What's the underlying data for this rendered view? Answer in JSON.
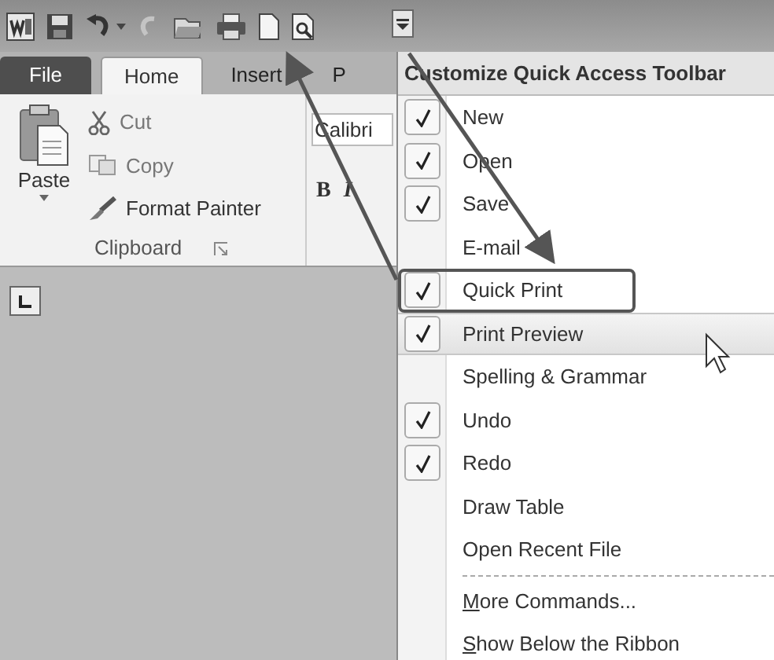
{
  "tabs": [
    {
      "label": "File",
      "kind": "file",
      "selected": false
    },
    {
      "label": "Home",
      "kind": "tab",
      "selected": true
    },
    {
      "label": "Insert",
      "kind": "tab",
      "selected": false
    },
    {
      "label": "P",
      "kind": "tab",
      "selected": false
    }
  ],
  "ribbon": {
    "paste": "Paste",
    "cut": "Cut",
    "copy": "Copy",
    "format_painter": "Format Painter",
    "group_label": "Clipboard",
    "font_name": "Calibri",
    "bold": "B",
    "italic": "I"
  },
  "menu": {
    "title": "Customize Quick Access Toolbar",
    "items": [
      {
        "label": "New",
        "checked": true,
        "selected": false,
        "outlined": false
      },
      {
        "label": "Open",
        "checked": true,
        "selected": false,
        "outlined": false
      },
      {
        "label": "Save",
        "checked": true,
        "selected": false,
        "outlined": false
      },
      {
        "label": "E-mail",
        "checked": false,
        "selected": false,
        "outlined": false
      },
      {
        "label": "Quick Print",
        "checked": true,
        "selected": false,
        "outlined": true
      },
      {
        "label": "Print Preview",
        "checked": true,
        "selected": true,
        "outlined": false
      },
      {
        "label": "Spelling & Grammar",
        "checked": false,
        "selected": false,
        "outlined": false
      },
      {
        "label": "Undo",
        "checked": true,
        "selected": false,
        "outlined": false
      },
      {
        "label": "Redo",
        "checked": true,
        "selected": false,
        "outlined": false
      },
      {
        "label": "Draw Table",
        "checked": false,
        "selected": false,
        "outlined": false
      },
      {
        "label": "Open Recent File",
        "checked": false,
        "selected": false,
        "outlined": false
      }
    ],
    "commands": [
      {
        "label": "More Commands...",
        "underline_first": true
      },
      {
        "label": "Show Below the Ribbon",
        "underline_first": true
      }
    ]
  }
}
